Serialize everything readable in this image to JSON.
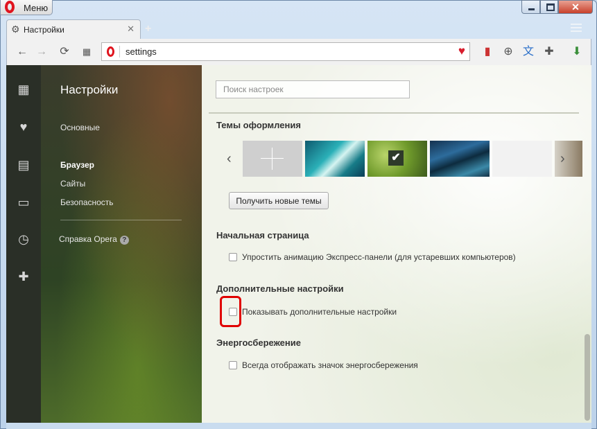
{
  "window": {
    "menu_label": "Меню",
    "close_glyph": "✕"
  },
  "tabs": [
    {
      "title": "Настройки",
      "icon": "gear-icon",
      "close_glyph": "✕"
    }
  ],
  "new_tab_glyph": "+",
  "address_bar": {
    "url": "settings"
  },
  "toolbar_icons": {
    "back": "←",
    "forward": "→",
    "reload": "⟳",
    "speed_dial": "▦",
    "heart": "♥",
    "bookmark": "▮",
    "globe": "⊕",
    "translate": "文",
    "extensions": "✚",
    "download": "⬇"
  },
  "sidebar_icons": [
    "grid-icon",
    "heart-icon",
    "news-icon",
    "devices-icon",
    "history-icon",
    "extensions-icon"
  ],
  "left_panel": {
    "title": "Настройки",
    "items": [
      {
        "label": "Основные",
        "active": false
      },
      {
        "label": "Браузер",
        "active": true
      },
      {
        "label": "Сайты",
        "active": false
      },
      {
        "label": "Безопасность",
        "active": false
      }
    ],
    "help": "Справка Opera",
    "help_glyph": "?"
  },
  "main": {
    "search_placeholder": "Поиск настроек",
    "themes_title": "Темы оформления",
    "themes_button": "Получить новые темы",
    "themes_selected_mark": "✔",
    "start_page_title": "Начальная страница",
    "start_page_option": "Упростить анимацию Экспресс-панели (для устаревших компьютеров)",
    "advanced_title": "Дополнительные настройки",
    "advanced_option": "Показывать дополнительные настройки",
    "power_title": "Энергосбережение",
    "power_option": "Всегда отображать значок энергосбережения",
    "arrow_left": "‹",
    "arrow_right": "›"
  },
  "colors": {
    "opera_red": "#e0141e",
    "highlight_red": "#e00000"
  }
}
